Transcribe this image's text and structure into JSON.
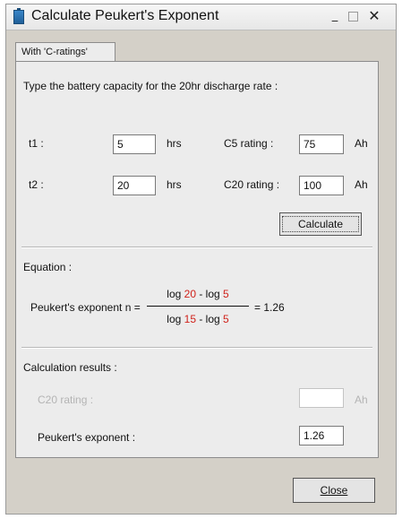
{
  "window": {
    "title": "Calculate Peukert's Exponent"
  },
  "titlebar_buttons": {
    "minimize": "_",
    "maximize": "",
    "close": "✕"
  },
  "tab": {
    "label": "With 'C-ratings'"
  },
  "instructions": "Type the battery capacity for the 20hr discharge rate :",
  "inputs": {
    "t1": {
      "label": "t1 :",
      "value": "5",
      "unit": "hrs"
    },
    "t2": {
      "label": "t2 :",
      "value": "20",
      "unit": "hrs"
    },
    "c5": {
      "label": "C5 rating :",
      "value": "75",
      "unit": "Ah"
    },
    "c20": {
      "label": "C20 rating :",
      "value": "100",
      "unit": "Ah"
    }
  },
  "calculate_label": "Calculate",
  "equation": {
    "section_label": "Equation :",
    "prefix": "Peukert's exponent n =",
    "num_a": "20",
    "num_b": "5",
    "den_a": "15",
    "den_b": "5",
    "log": "log",
    "minus": " - ",
    "result": "= 1.26"
  },
  "results": {
    "section_label": "Calculation results :",
    "c20_label": "C20 rating :",
    "c20_value": "",
    "c20_unit": "Ah",
    "exponent_label": "Peukert's exponent :",
    "exponent_value": "1.26"
  },
  "close_label": "Close",
  "colors": {
    "highlight": "#d0221b",
    "window_bg": "#d4d0c8",
    "panel_bg": "#ececec"
  }
}
